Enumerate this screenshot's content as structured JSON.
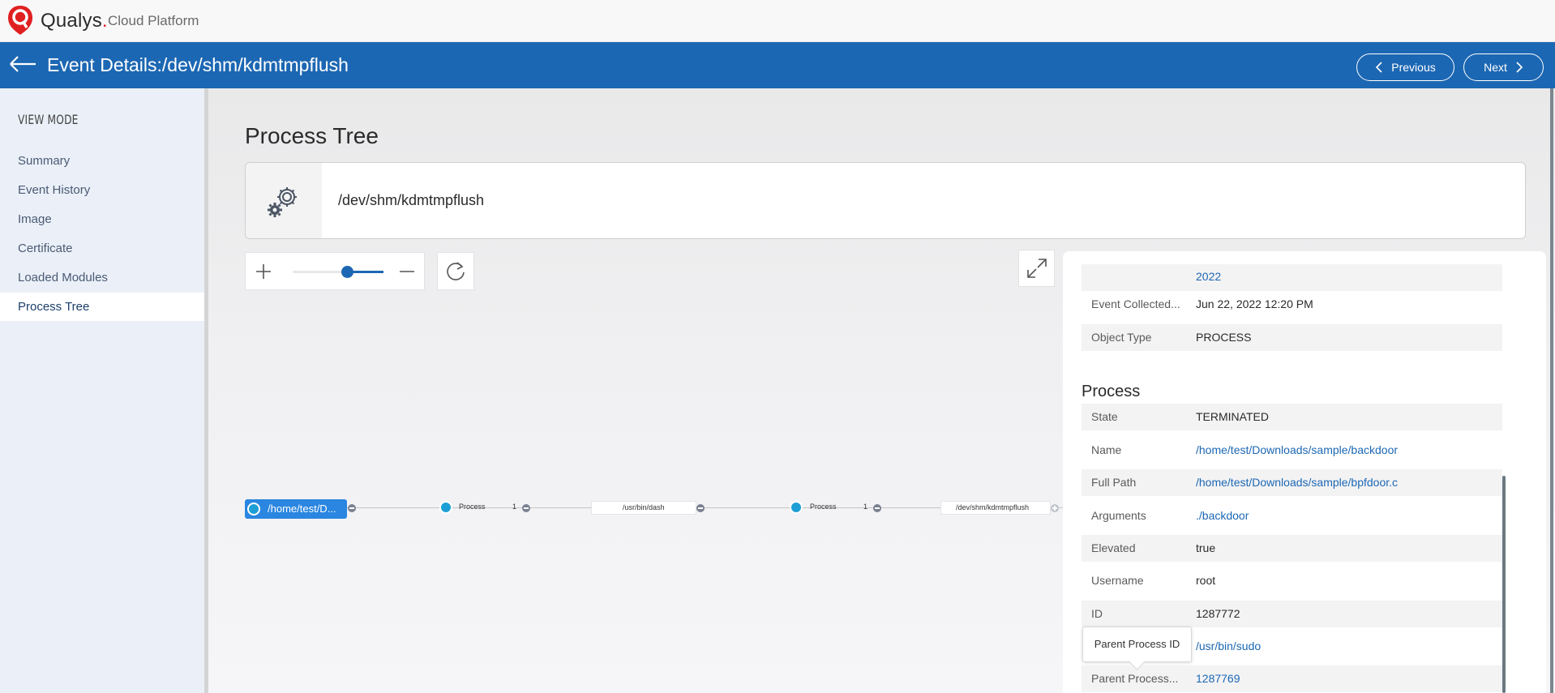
{
  "app": {
    "brand": "Qualys",
    "brand_sub": "Cloud Platform"
  },
  "header": {
    "title": "Event Details:/dev/shm/kdmtmpflush",
    "previous_label": "Previous",
    "next_label": "Next"
  },
  "sidebar": {
    "heading": "VIEW MODE",
    "items": [
      {
        "label": "Summary"
      },
      {
        "label": "Event History"
      },
      {
        "label": "Image"
      },
      {
        "label": "Certificate"
      },
      {
        "label": "Loaded Modules"
      },
      {
        "label": "Process Tree",
        "active": true
      }
    ]
  },
  "main": {
    "title": "Process Tree",
    "process_name": "/dev/shm/kdmtmpflush",
    "zoom_level": 0.6
  },
  "tree": {
    "root_label": "/home/test/D...",
    "nodes": [
      {
        "label": "Process",
        "count": "1"
      },
      {
        "label": "/usr/bin/dash"
      },
      {
        "label": "Process",
        "count": "1"
      },
      {
        "label": "/dev/shm/kdmtmpflush"
      }
    ]
  },
  "details": {
    "top_rows": [
      {
        "label": "",
        "value": "2022",
        "link": true
      },
      {
        "label": "Event Collected...",
        "value": "Jun 22, 2022 12:20 PM"
      },
      {
        "label": "Object Type",
        "value": "PROCESS"
      }
    ],
    "process_section_title": "Process",
    "process_rows": [
      {
        "label": "State",
        "value": "TERMINATED"
      },
      {
        "label": "Name",
        "value": "/home/test/Downloads/sample/backdoor",
        "link": true
      },
      {
        "label": "Full Path",
        "value": "/home/test/Downloads/sample/bpfdoor.c",
        "link": true
      },
      {
        "label": "Arguments",
        "value": "./backdoor",
        "link": true
      },
      {
        "label": "Elevated",
        "value": "true"
      },
      {
        "label": "Username",
        "value": "root"
      },
      {
        "label": "ID",
        "value": "1287772"
      },
      {
        "label": "",
        "value": "/usr/bin/sudo",
        "link": true
      },
      {
        "label": "Parent Process...",
        "value": "1287769",
        "link": true
      }
    ],
    "tooltip": "Parent Process ID"
  },
  "colors": {
    "primary": "#1c67b3",
    "node_blue": "#2a86e0",
    "logo_red": "#e02020"
  }
}
